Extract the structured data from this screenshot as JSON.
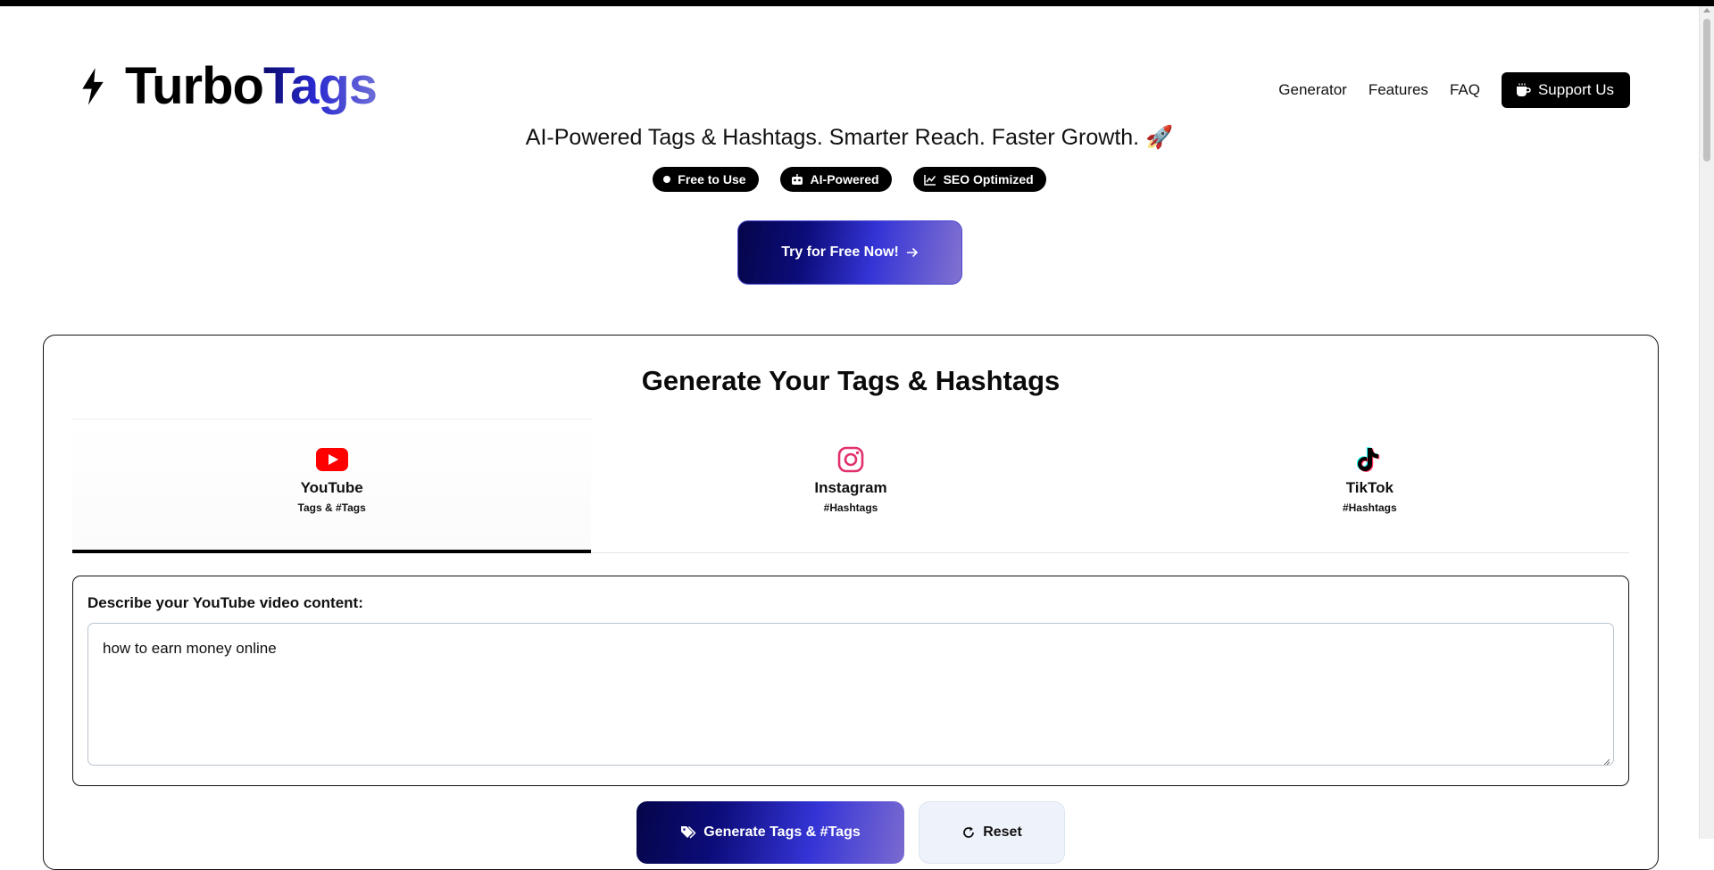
{
  "brand": {
    "name_part1": "Turbo",
    "name_part2": "Tags",
    "icon": "lightning-bolt-icon"
  },
  "nav": {
    "links": [
      "Generator",
      "Features",
      "FAQ"
    ],
    "support_label": "Support Us",
    "support_icon": "coffee-cup-icon"
  },
  "hero": {
    "tagline": "AI-Powered Tags & Hashtags. Smarter Reach. Faster Growth. 🚀",
    "badges": [
      {
        "label": "Free to Use",
        "icon": "dot-icon"
      },
      {
        "label": "AI-Powered",
        "icon": "robot-icon"
      },
      {
        "label": "SEO Optimized",
        "icon": "chart-line-icon"
      }
    ],
    "cta_label": "Try for Free Now!",
    "cta_icon": "arrow-right-icon"
  },
  "generator": {
    "title": "Generate Your Tags & Hashtags",
    "tabs": [
      {
        "name": "YouTube",
        "sub": "Tags & #Tags",
        "icon": "youtube-icon",
        "active": true
      },
      {
        "name": "Instagram",
        "sub": "#Hashtags",
        "icon": "instagram-icon",
        "active": false
      },
      {
        "name": "TikTok",
        "sub": "#Hashtags",
        "icon": "tiktok-icon",
        "active": false
      }
    ],
    "input_label": "Describe your YouTube video content:",
    "input_value": "how to earn money online",
    "generate_label": "Generate Tags & #Tags",
    "reset_label": "Reset"
  },
  "colors": {
    "accent_dark": "#05054a",
    "accent_mid": "#3434d6",
    "accent_light": "#8272d0",
    "youtube_red": "#ff0000",
    "instagram_pink": "#e1306c"
  }
}
